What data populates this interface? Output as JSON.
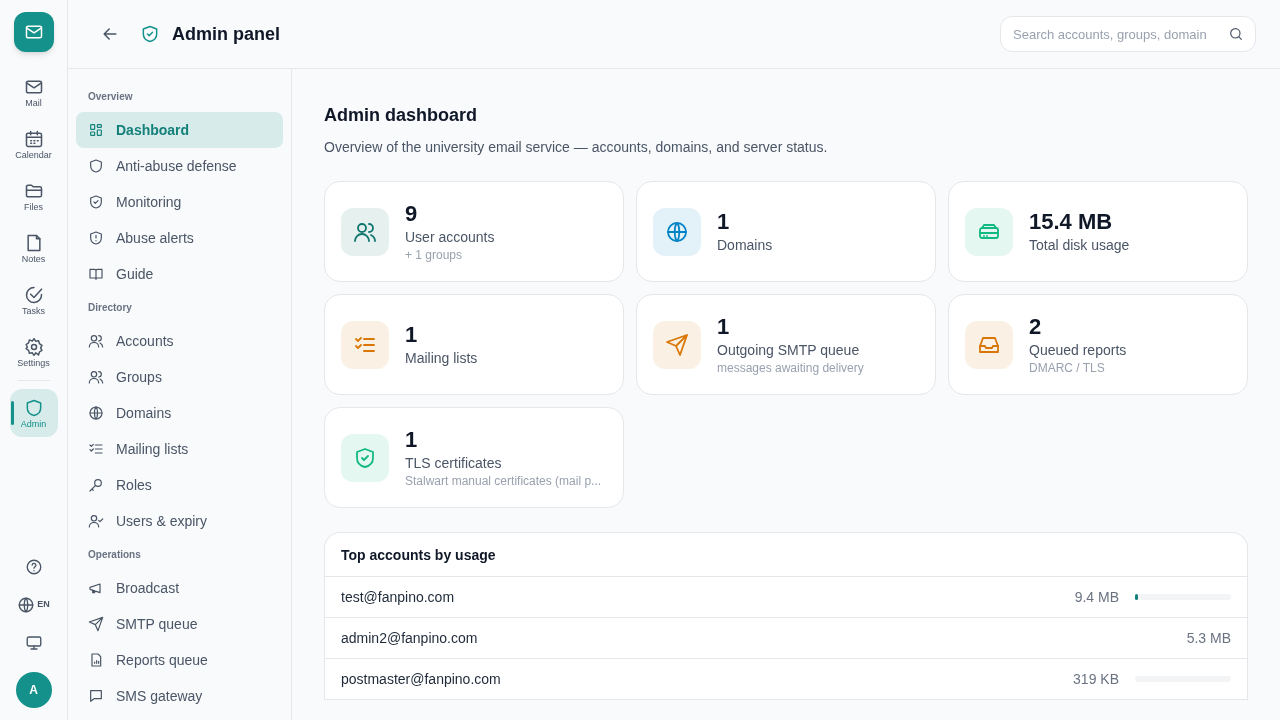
{
  "rail": {
    "items": [
      {
        "label": "Mail",
        "selected": false
      },
      {
        "label": "Calendar",
        "selected": false
      },
      {
        "label": "Files",
        "selected": false
      },
      {
        "label": "Notes",
        "selected": false
      },
      {
        "label": "Tasks",
        "selected": false
      },
      {
        "label": "Settings",
        "selected": false
      },
      {
        "label": "Admin",
        "selected": true
      }
    ],
    "language": "EN",
    "avatar": "A"
  },
  "header": {
    "title": "Admin panel",
    "search": {
      "placeholder": "Search accounts, groups, domain"
    }
  },
  "nav": [
    {
      "heading": "Overview",
      "items": [
        {
          "label": "Dashboard",
          "selected": true
        },
        {
          "label": "Anti-abuse defense",
          "selected": false
        },
        {
          "label": "Monitoring",
          "selected": false
        },
        {
          "label": "Abuse alerts",
          "selected": false
        },
        {
          "label": "Guide",
          "selected": false
        }
      ]
    },
    {
      "heading": "Directory",
      "items": [
        {
          "label": "Accounts",
          "selected": false
        },
        {
          "label": "Groups",
          "selected": false
        },
        {
          "label": "Domains",
          "selected": false
        },
        {
          "label": "Mailing lists",
          "selected": false
        },
        {
          "label": "Roles",
          "selected": false
        },
        {
          "label": "Users & expiry",
          "selected": false
        }
      ]
    },
    {
      "heading": "Operations",
      "items": [
        {
          "label": "Broadcast",
          "selected": false
        },
        {
          "label": "SMTP queue",
          "selected": false
        },
        {
          "label": "Reports queue",
          "selected": false
        },
        {
          "label": "SMS gateway",
          "selected": false
        }
      ]
    }
  ],
  "page": {
    "title": "Admin dashboard",
    "subtitle": "Overview of the university email service — accounts, domains, and server status."
  },
  "stats": [
    {
      "value": "9",
      "label": "User accounts",
      "note": "+ 1 groups",
      "color": "#0f766e"
    },
    {
      "value": "1",
      "label": "Domains",
      "color": "#0284c7"
    },
    {
      "value": "15.4 MB",
      "label": "Total disk usage",
      "color": "#10b981"
    },
    {
      "value": "1",
      "label": "Mailing lists",
      "color": "#d97706"
    },
    {
      "value": "1",
      "label": "Outgoing SMTP queue",
      "note": "messages awaiting delivery",
      "color": "#d97706"
    },
    {
      "value": "2",
      "label": "Queued reports",
      "note": "DMARC / TLS",
      "color": "#d97706"
    },
    {
      "value": "1",
      "label": "TLS certificates",
      "note": "Stalwart manual certificates (mail p...",
      "color": "#10b981"
    }
  ],
  "top_accounts": {
    "title": "Top accounts by usage",
    "rows": [
      {
        "account": "test@fanpino.com",
        "usage": "9.4 MB",
        "level": 0.03
      },
      {
        "account": "admin2@fanpino.com",
        "usage": "5.3 MB"
      },
      {
        "account": "postmaster@fanpino.com",
        "usage": "319 KB",
        "level": 0
      }
    ]
  }
}
